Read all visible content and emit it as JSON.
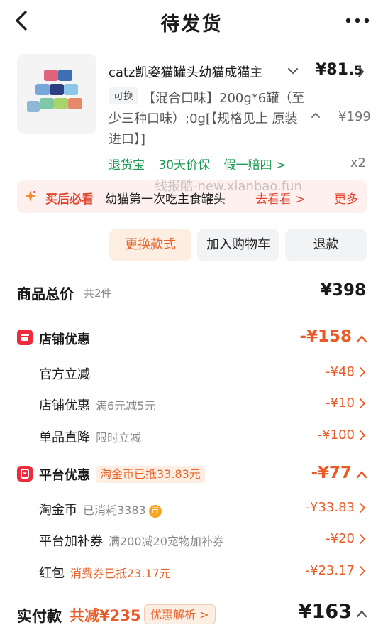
{
  "header": {
    "title": "待发货"
  },
  "product": {
    "name": "catz凯姿猫罐头幼猫成猫主",
    "price_main": "¥81.",
    "price_frac": "5",
    "exchange_tag": "可换",
    "spec": "【混合口味】200g*6罐（至少三种口味）;0g[【规格见上 原装进口】]",
    "original_price": "¥199",
    "services": [
      "退货宝",
      "30天价保",
      "假一赔四 >"
    ],
    "quantity": "x2"
  },
  "banner": {
    "label": "买后必看",
    "text": "幼猫第一次吃主食罐头",
    "go": "去看看 >",
    "more": "更多"
  },
  "watermark": "线报酷-new.xianbao.fun",
  "actions": {
    "change": "更换款式",
    "cart": "加入购物车",
    "refund": "退款"
  },
  "total": {
    "label": "商品总价",
    "count": "共2件",
    "value": "¥398"
  },
  "shop_discount": {
    "label": "店铺优惠",
    "value": "-¥158",
    "items": [
      {
        "label": "官方立减",
        "note": "",
        "value": "-¥48"
      },
      {
        "label": "店铺优惠",
        "note": "满6元减5元",
        "value": "-¥10"
      },
      {
        "label": "单品直降",
        "note": "限时立减",
        "value": "-¥100"
      }
    ]
  },
  "platform_discount": {
    "label": "平台优惠",
    "pill": "淘金币已抵33.83元",
    "value": "-¥77",
    "items": [
      {
        "label": "淘金币",
        "note": "已消耗3383",
        "coin": "币",
        "value": "-¥33.83"
      },
      {
        "label": "平台加补券",
        "note": "满200减20宠物加补券",
        "value": "-¥20"
      },
      {
        "label": "红包",
        "note": "消费券已抵23.17元",
        "value": "-¥23.17"
      }
    ]
  },
  "payment": {
    "label": "实付款",
    "saved": "共减¥235",
    "analysis": "优惠解析 >",
    "value": "¥163"
  },
  "colors": {
    "accent": "#ea5a26",
    "red": "#ee2b3c",
    "green": "#1d9a52"
  }
}
